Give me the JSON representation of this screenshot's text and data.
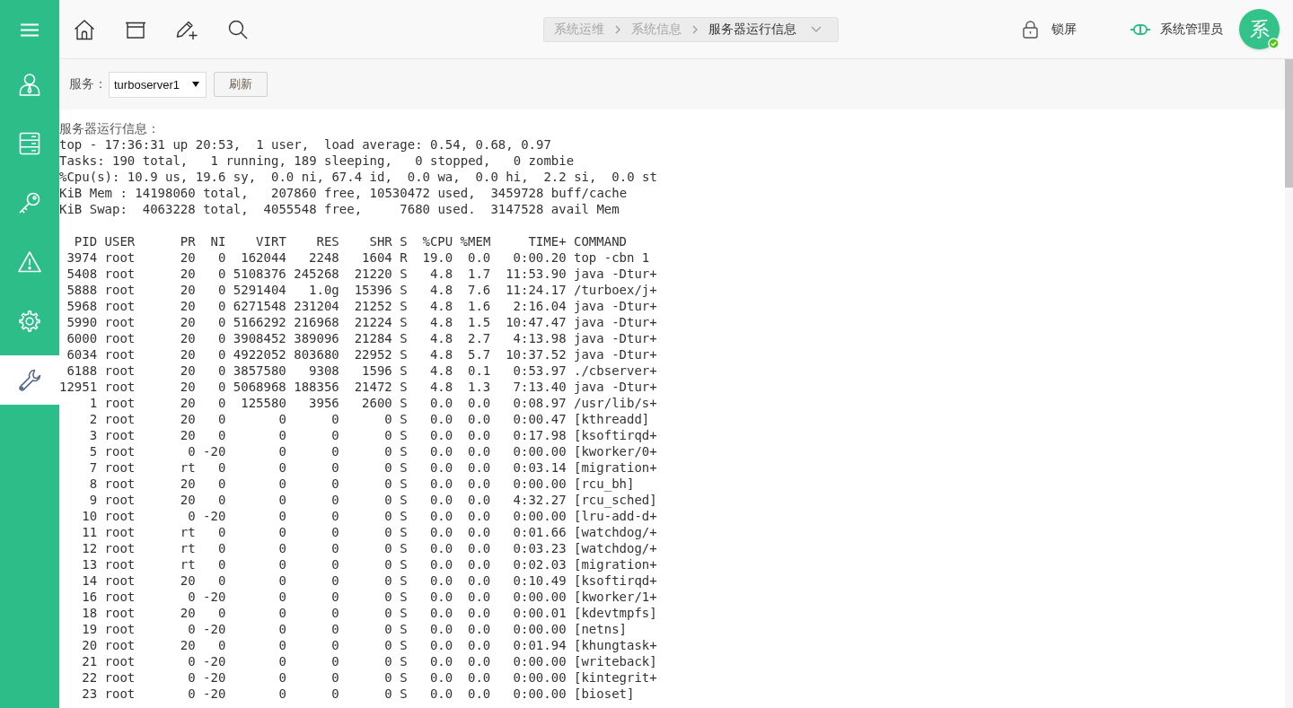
{
  "sidebar": {
    "items": [
      {
        "selected": false
      },
      {
        "selected": false
      },
      {
        "selected": false
      },
      {
        "selected": false
      },
      {
        "selected": false
      },
      {
        "selected": true
      }
    ]
  },
  "top_bar": {
    "breadcrumb": [
      {
        "label": "系统运维",
        "current": false
      },
      {
        "label": "系统信息",
        "current": false
      },
      {
        "label": "服务器运行信息",
        "current": true
      }
    ],
    "lock": {
      "label": "锁屏"
    },
    "user": {
      "name": "系统管理员",
      "avatar": {
        "initial": "系",
        "verified": true
      }
    }
  },
  "toolbar": {
    "service_label": "服务：",
    "service_select": {
      "value": "turboserver1"
    },
    "refresh_button": "刷新"
  },
  "output": {
    "title": "服务器运行信息：",
    "summary_lines": [
      "top - 17:36:31 up 20:53,  1 user,  load average: 0.54, 0.68, 0.97",
      "Tasks: 190 total,   1 running, 189 sleeping,   0 stopped,   0 zombie",
      "%Cpu(s): 10.9 us, 19.6 sy,  0.0 ni, 67.4 id,  0.0 wa,  0.0 hi,  2.2 si,  0.0 st",
      "KiB Mem : 14198060 total,   207860 free, 10530472 used,  3459728 buff/cache",
      "KiB Swap:  4063228 total,  4055548 free,     7680 used.  3147528 avail Mem"
    ],
    "process_table": {
      "columns": [
        "PID",
        "USER",
        "PR",
        "NI",
        "VIRT",
        "RES",
        "SHR",
        "S",
        "%CPU",
        "%MEM",
        "TIME+",
        "COMMAND"
      ],
      "rows": [
        [
          "3974",
          "root",
          "20",
          "0",
          "162044",
          "2248",
          "1604",
          "R",
          "19.0",
          "0.0",
          "0:00.20",
          "top -cbn 1"
        ],
        [
          "5408",
          "root",
          "20",
          "0",
          "5108376",
          "245268",
          "21220",
          "S",
          "4.8",
          "1.7",
          "11:53.90",
          "java -Dtur+"
        ],
        [
          "5888",
          "root",
          "20",
          "0",
          "5291404",
          "1.0g",
          "15396",
          "S",
          "4.8",
          "7.6",
          "11:24.17",
          "/turboex/j+"
        ],
        [
          "5968",
          "root",
          "20",
          "0",
          "6271548",
          "231204",
          "21252",
          "S",
          "4.8",
          "1.6",
          "2:16.04",
          "java -Dtur+"
        ],
        [
          "5990",
          "root",
          "20",
          "0",
          "5166292",
          "216968",
          "21224",
          "S",
          "4.8",
          "1.5",
          "10:47.47",
          "java -Dtur+"
        ],
        [
          "6000",
          "root",
          "20",
          "0",
          "3908452",
          "389096",
          "21284",
          "S",
          "4.8",
          "2.7",
          "4:13.98",
          "java -Dtur+"
        ],
        [
          "6034",
          "root",
          "20",
          "0",
          "4922052",
          "803680",
          "22952",
          "S",
          "4.8",
          "5.7",
          "10:37.52",
          "java -Dtur+"
        ],
        [
          "6188",
          "root",
          "20",
          "0",
          "3857580",
          "9308",
          "1596",
          "S",
          "4.8",
          "0.1",
          "0:53.97",
          "./cbserver+"
        ],
        [
          "12951",
          "root",
          "20",
          "0",
          "5068968",
          "188356",
          "21472",
          "S",
          "4.8",
          "1.3",
          "7:13.40",
          "java -Dtur+"
        ],
        [
          "1",
          "root",
          "20",
          "0",
          "125580",
          "3956",
          "2600",
          "S",
          "0.0",
          "0.0",
          "0:08.97",
          "/usr/lib/s+"
        ],
        [
          "2",
          "root",
          "20",
          "0",
          "0",
          "0",
          "0",
          "S",
          "0.0",
          "0.0",
          "0:00.47",
          "[kthreadd]"
        ],
        [
          "3",
          "root",
          "20",
          "0",
          "0",
          "0",
          "0",
          "S",
          "0.0",
          "0.0",
          "0:17.98",
          "[ksoftirqd+"
        ],
        [
          "5",
          "root",
          "0",
          "-20",
          "0",
          "0",
          "0",
          "S",
          "0.0",
          "0.0",
          "0:00.00",
          "[kworker/0+"
        ],
        [
          "7",
          "root",
          "rt",
          "0",
          "0",
          "0",
          "0",
          "S",
          "0.0",
          "0.0",
          "0:03.14",
          "[migration+"
        ],
        [
          "8",
          "root",
          "20",
          "0",
          "0",
          "0",
          "0",
          "S",
          "0.0",
          "0.0",
          "0:00.00",
          "[rcu_bh]"
        ],
        [
          "9",
          "root",
          "20",
          "0",
          "0",
          "0",
          "0",
          "S",
          "0.0",
          "0.0",
          "4:32.27",
          "[rcu_sched]"
        ],
        [
          "10",
          "root",
          "0",
          "-20",
          "0",
          "0",
          "0",
          "S",
          "0.0",
          "0.0",
          "0:00.00",
          "[lru-add-d+"
        ],
        [
          "11",
          "root",
          "rt",
          "0",
          "0",
          "0",
          "0",
          "S",
          "0.0",
          "0.0",
          "0:01.66",
          "[watchdog/+"
        ],
        [
          "12",
          "root",
          "rt",
          "0",
          "0",
          "0",
          "0",
          "S",
          "0.0",
          "0.0",
          "0:03.23",
          "[watchdog/+"
        ],
        [
          "13",
          "root",
          "rt",
          "0",
          "0",
          "0",
          "0",
          "S",
          "0.0",
          "0.0",
          "0:02.03",
          "[migration+"
        ],
        [
          "14",
          "root",
          "20",
          "0",
          "0",
          "0",
          "0",
          "S",
          "0.0",
          "0.0",
          "0:10.49",
          "[ksoftirqd+"
        ],
        [
          "16",
          "root",
          "0",
          "-20",
          "0",
          "0",
          "0",
          "S",
          "0.0",
          "0.0",
          "0:00.00",
          "[kworker/1+"
        ],
        [
          "18",
          "root",
          "20",
          "0",
          "0",
          "0",
          "0",
          "S",
          "0.0",
          "0.0",
          "0:00.01",
          "[kdevtmpfs]"
        ],
        [
          "19",
          "root",
          "0",
          "-20",
          "0",
          "0",
          "0",
          "S",
          "0.0",
          "0.0",
          "0:00.00",
          "[netns]"
        ],
        [
          "20",
          "root",
          "20",
          "0",
          "0",
          "0",
          "0",
          "S",
          "0.0",
          "0.0",
          "0:01.94",
          "[khungtask+"
        ],
        [
          "21",
          "root",
          "0",
          "-20",
          "0",
          "0",
          "0",
          "S",
          "0.0",
          "0.0",
          "0:00.00",
          "[writeback]"
        ],
        [
          "22",
          "root",
          "0",
          "-20",
          "0",
          "0",
          "0",
          "S",
          "0.0",
          "0.0",
          "0:00.00",
          "[kintegrit+"
        ],
        [
          "23",
          "root",
          "0",
          "-20",
          "0",
          "0",
          "0",
          "S",
          "0.0",
          "0.0",
          "0:00.00",
          "[bioset]"
        ]
      ]
    }
  }
}
